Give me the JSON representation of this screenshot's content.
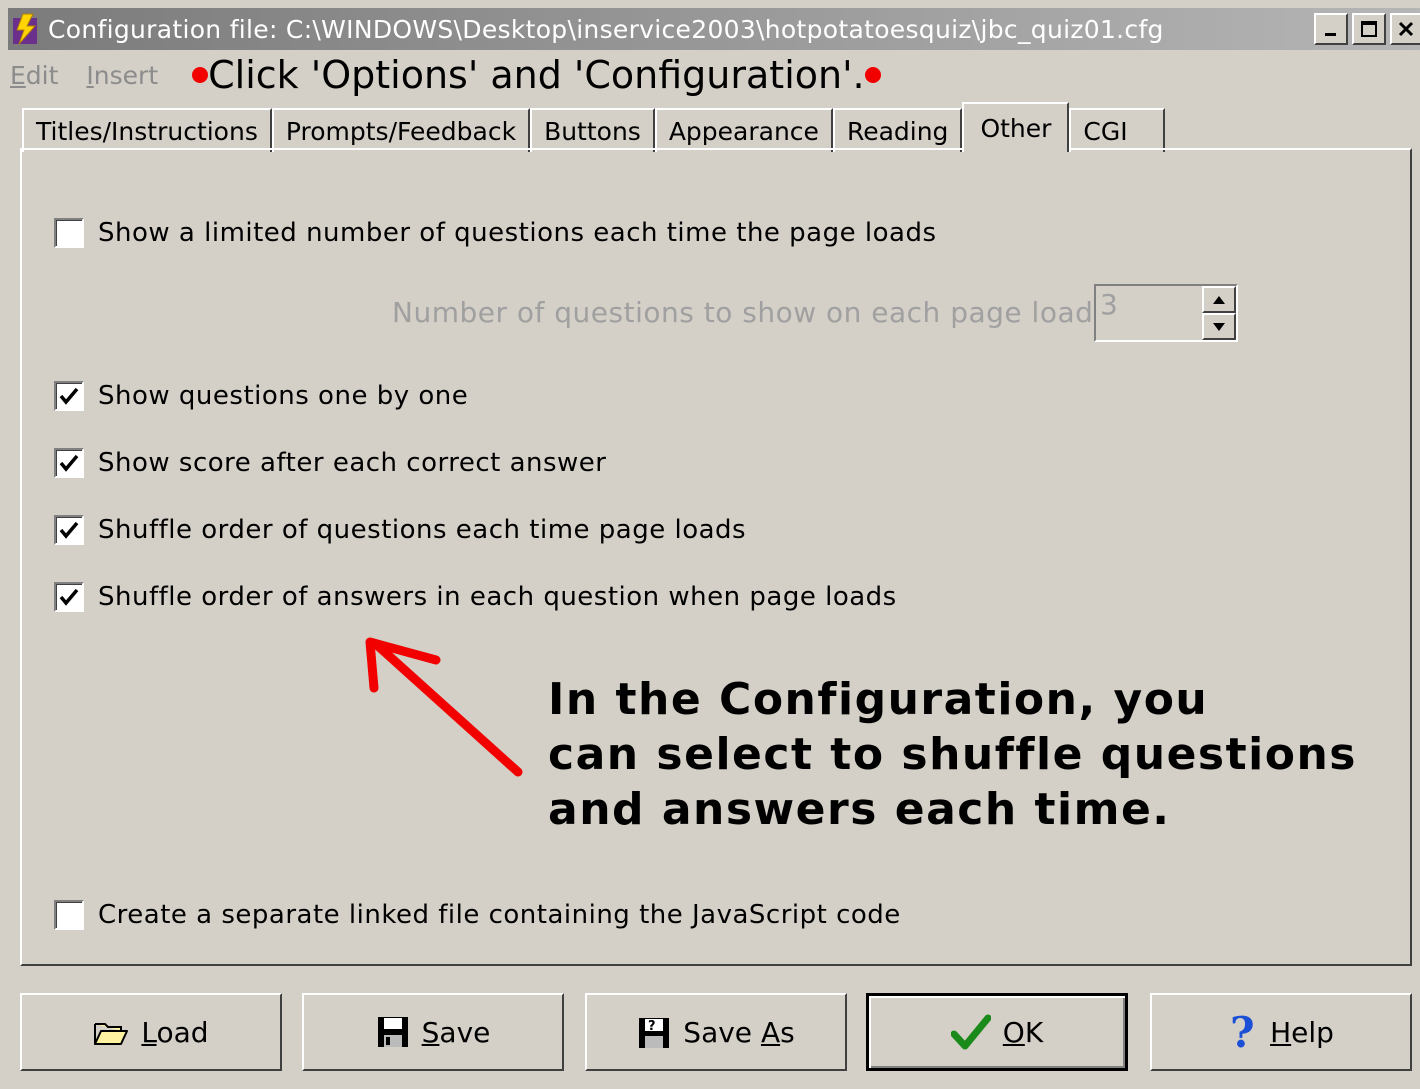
{
  "window": {
    "title": "Configuration file: C:\\WINDOWS\\Desktop\\inservice2003\\hotpotatoesquiz\\jbc_quiz01.cfg"
  },
  "menu": {
    "edit_first": "E",
    "edit_rest": "dit",
    "insert_first": "I",
    "insert_rest": "nsert"
  },
  "instruction": "Click 'Options' and 'Configuration'.",
  "tabs": [
    {
      "label": "Titles/Instructions"
    },
    {
      "label": "Prompts/Feedback"
    },
    {
      "label": "Buttons"
    },
    {
      "label": "Appearance"
    },
    {
      "label": "Reading"
    },
    {
      "label": "Other",
      "active": true
    },
    {
      "label": "CGI"
    }
  ],
  "options": {
    "limited": {
      "label": "Show a limited number of questions each time the page loads",
      "checked": false
    },
    "num_label": "Number of questions to show on each page load:",
    "num_value": "3",
    "one_by_one": {
      "label": "Show questions one by one",
      "checked": true
    },
    "score": {
      "label": "Show score after each correct answer",
      "checked": true
    },
    "shuffle_q": {
      "label": "Shuffle order of questions each time page loads",
      "checked": true
    },
    "shuffle_a": {
      "label": "Shuffle order of answers in each question when page loads",
      "checked": true
    },
    "separate_js": {
      "label": "Create a separate linked file containing the JavaScript code",
      "checked": false
    }
  },
  "annotation": {
    "line1": "In the Configuration, you",
    "line2": "can select to shuffle questions",
    "line3": "and answers each time."
  },
  "buttons": {
    "load_u": "L",
    "load_rest": "oad",
    "save_u": "S",
    "save_rest": "ave",
    "saveas_pre": "Save ",
    "saveas_u": "A",
    "saveas_rest": "s",
    "ok_u": "O",
    "ok_rest": "K",
    "help_u": "H",
    "help_rest": "elp"
  },
  "colors": {
    "red": "#f20000",
    "check_green": "#1a8a1a",
    "help_blue": "#1a4fd6"
  }
}
